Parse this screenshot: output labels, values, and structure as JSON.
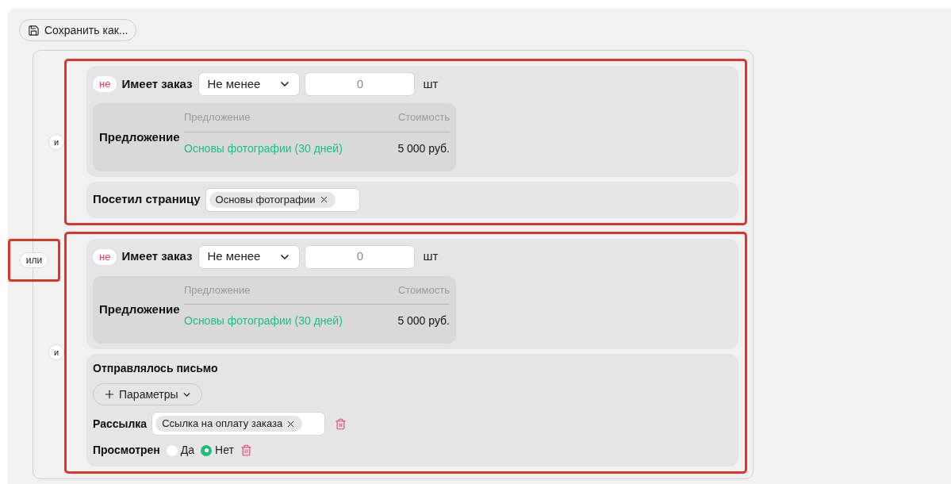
{
  "save_button": {
    "label": "Сохранить как..."
  },
  "or_connector": {
    "label": "или",
    "highlighted": true
  },
  "groups": [
    {
      "highlighted": true,
      "and_label": "и",
      "conditions": [
        {
          "kind": "order",
          "negate_label": "не",
          "label": "Имеет заказ",
          "operator": "Не менее",
          "count": "0",
          "unit": "шт",
          "offer": {
            "label": "Предложение",
            "columns": [
              "Предложение",
              "Стоимость"
            ],
            "rows": [
              {
                "name": "Основы фотографии (30 дней)",
                "price": "5 000 руб."
              }
            ]
          }
        },
        {
          "kind": "page_visit",
          "label": "Посетил страницу",
          "tags": [
            "Основы фотографии"
          ]
        }
      ]
    },
    {
      "highlighted": true,
      "and_label": "и",
      "conditions": [
        {
          "kind": "order",
          "negate_label": "не",
          "label": "Имеет заказ",
          "operator": "Не менее",
          "count": "0",
          "unit": "шт",
          "offer": {
            "label": "Предложение",
            "columns": [
              "Предложение",
              "Стоимость"
            ],
            "rows": [
              {
                "name": "Основы фотографии (30 дней)",
                "price": "5 000 руб."
              }
            ]
          }
        },
        {
          "kind": "email",
          "label": "Отправлялось письмо",
          "params_button": "Параметры",
          "fields": [
            {
              "kind": "tags",
              "label": "Рассылка",
              "tags": [
                "Ссылка на оплату заказа"
              ]
            },
            {
              "kind": "radio",
              "label": "Просмотрен",
              "options": [
                {
                  "label": "Да",
                  "selected": false
                },
                {
                  "label": "Нет",
                  "selected": true
                }
              ]
            }
          ]
        }
      ]
    }
  ]
}
